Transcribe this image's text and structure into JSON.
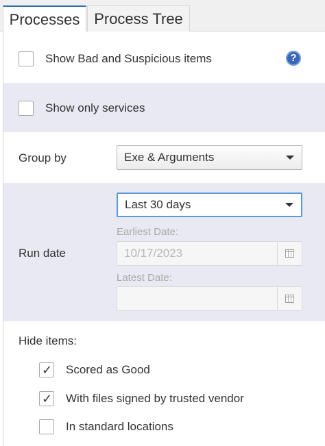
{
  "tabs": [
    {
      "label": "Processes",
      "active": true
    },
    {
      "label": "Process Tree",
      "active": false
    }
  ],
  "filters": {
    "bad_suspicious": {
      "label": "Show Bad and Suspicious items",
      "checked": false
    },
    "only_services": {
      "label": "Show only services",
      "checked": false
    }
  },
  "help_icon": {
    "glyph": "?",
    "icon": "help-icon"
  },
  "group_by": {
    "label": "Group by",
    "value": "Exe & Arguments"
  },
  "run_date": {
    "label": "Run date",
    "range": "Last 30 days",
    "earliest_label": "Earliest Date:",
    "earliest_value": "10/17/2023",
    "latest_label": "Latest Date:",
    "latest_value": ""
  },
  "hide_items": {
    "label": "Hide items:",
    "options": [
      {
        "label": "Scored as Good",
        "checked": true
      },
      {
        "label": "With files signed by trusted vendor",
        "checked": true
      },
      {
        "label": "In standard locations",
        "checked": false
      }
    ]
  },
  "colors": {
    "accent": "#2a6fb8",
    "shade": "#e9e9f4",
    "help": "#3a66b8"
  }
}
